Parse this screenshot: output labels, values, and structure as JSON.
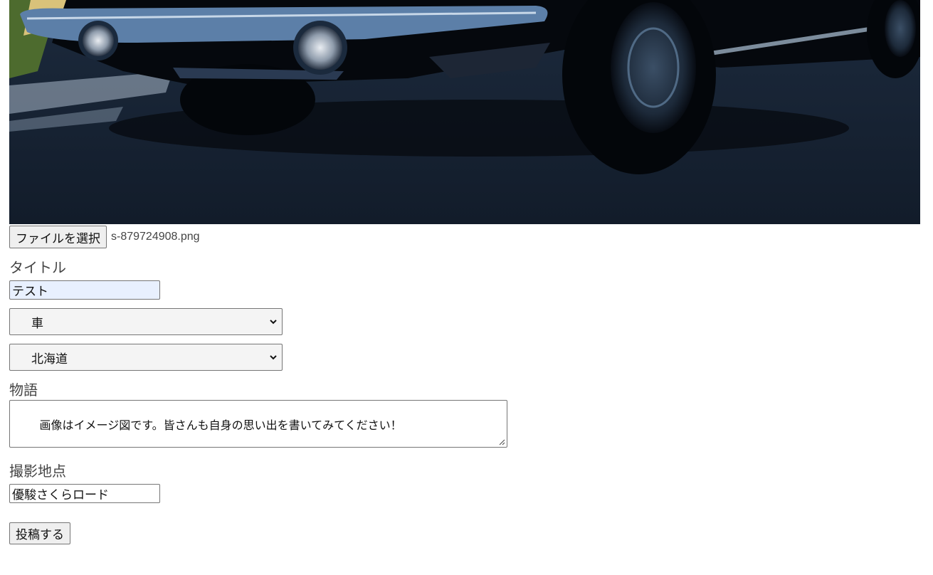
{
  "upload": {
    "choose_button_label": "ファイルを選択",
    "file_name": "s-879724908.png"
  },
  "form": {
    "title_label": "タイトル",
    "title_value": "テスト",
    "category_selected": "車",
    "prefecture_selected": "北海道",
    "story_label": "物語",
    "story_value": "画像はイメージ図です。皆さんも自身の思い出を書いてみてください！",
    "location_label": "撮影地点",
    "location_value": "優駿さくらロード",
    "submit_label": "投稿する"
  },
  "icons": {
    "select_arrow": "chevron-down-icon",
    "resize_grip": "resize-grip-icon"
  },
  "colors": {
    "autofill_background": "#e8f0fe",
    "select_background": "#f4f4f4",
    "button_background": "#efefef",
    "border": "#767676"
  }
}
